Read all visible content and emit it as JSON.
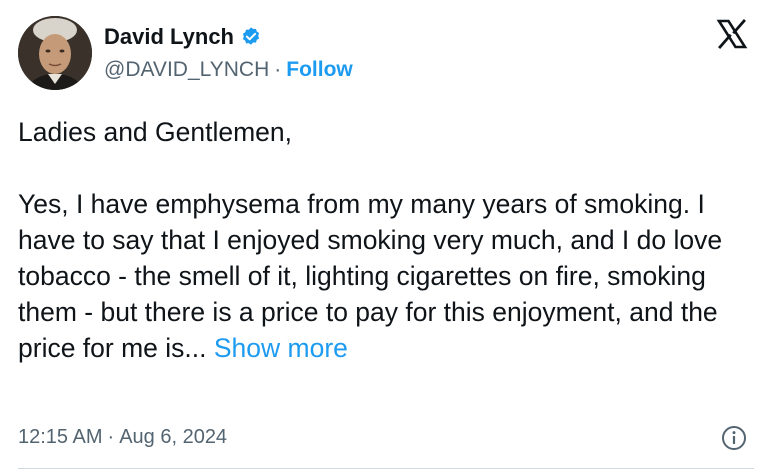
{
  "author": {
    "display_name": "David Lynch",
    "handle": "@DAVID_LYNCH",
    "verified": true,
    "follow_label": "Follow",
    "separator": "·"
  },
  "brand": {
    "logo_icon": "x-logo-icon",
    "accent_color": "#1d9bf0",
    "verified_color": "#1d9bf0"
  },
  "tweet": {
    "greeting": "Ladies and Gentlemen,",
    "body": "Yes, I have emphysema from my many years of smoking. I have to say that I enjoyed smoking very much, and I do love tobacco - the smell of it, lighting cigarettes on fire, smoking them - but there is a price to pay for this enjoyment, and the price for me is...",
    "show_more_label": "Show more"
  },
  "meta": {
    "time": "12:15 AM",
    "separator": "·",
    "date": "Aug 6, 2024",
    "info_icon": "info-icon"
  }
}
